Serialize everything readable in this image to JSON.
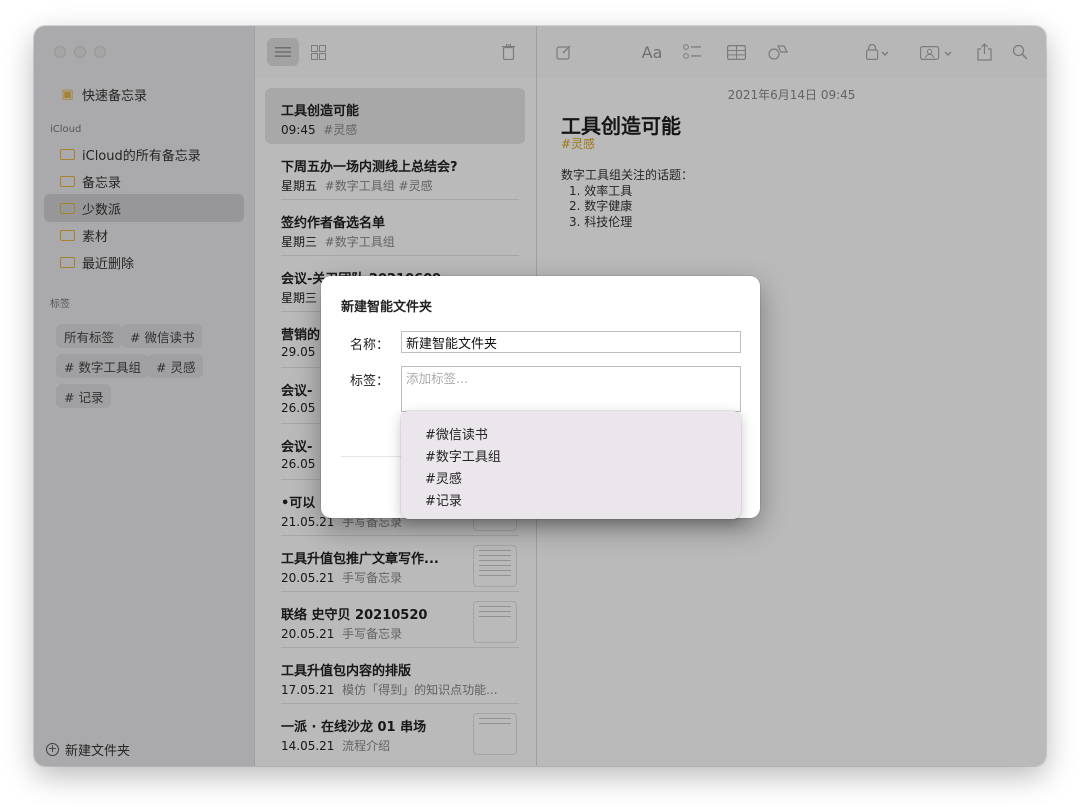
{
  "sidebar": {
    "quick_notes": "快速备忘录",
    "section_icloud": "iCloud",
    "folders": [
      {
        "label": "iCloud的所有备忘录"
      },
      {
        "label": "备忘录"
      },
      {
        "label": "少数派"
      },
      {
        "label": "素材"
      },
      {
        "label": "最近删除"
      }
    ],
    "section_tags": "标签",
    "tags": [
      "所有标签",
      "# 微信读书",
      "# 数字工具组",
      "# 灵感",
      "# 记录"
    ],
    "new_folder": "新建文件夹"
  },
  "notes": [
    {
      "title": "工具创造可能",
      "date": "09:45",
      "sub": "#灵感"
    },
    {
      "title": "下周五办一场内测线上总结会?",
      "date": "星期五",
      "sub": "#数字工具组 #灵感"
    },
    {
      "title": "签约作者备选名单",
      "date": "星期三",
      "sub": "#数字工具组"
    },
    {
      "title": "会议-关卫团队 20210609",
      "date": "星期三",
      "sub": ""
    },
    {
      "title": "营销的",
      "date": "29.05",
      "sub": ""
    },
    {
      "title": "会议-",
      "date": "26.05",
      "sub": ""
    },
    {
      "title": "会议-",
      "date": "26.05",
      "sub": ""
    },
    {
      "title": "•可以",
      "date": "21.05.21",
      "sub": "手写备忘录"
    },
    {
      "title": "工具升值包推广文章写作...",
      "date": "20.05.21",
      "sub": "手写备忘录"
    },
    {
      "title": "联络 史守贝 20210520",
      "date": "20.05.21",
      "sub": "手写备忘录"
    },
    {
      "title": "工具升值包内容的排版",
      "date": "17.05.21",
      "sub": "模仿「得到」的知识点功能..."
    },
    {
      "title": "一派 · 在线沙龙 01 串场",
      "date": "14.05.21",
      "sub": "流程介绍"
    }
  ],
  "editor": {
    "date": "2021年6月14日 09:45",
    "title": "工具创造可能",
    "tag": "#灵感",
    "intro": "数字工具组关注的话题：",
    "items": [
      "1. 效率工具",
      "2. 数字健康",
      "3. 科技伦理"
    ]
  },
  "dialog": {
    "title": "新建智能文件夹",
    "name_label": "名称：",
    "name_value": "新建智能文件夹",
    "tags_label": "标签：",
    "tags_placeholder": "添加标签...",
    "suggestions": [
      "#微信读书",
      "#数字工具组",
      "#灵感",
      "#记录"
    ]
  },
  "toolbar": {
    "font_button": "Aa"
  },
  "colors": {
    "accent": "#e3b341",
    "tag_color": "#d9a520"
  }
}
